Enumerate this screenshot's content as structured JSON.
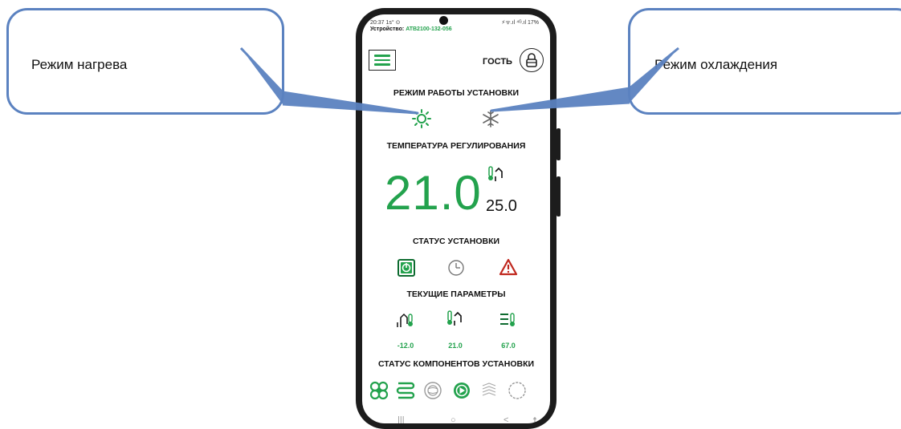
{
  "callouts": {
    "left": "Режим нагрева",
    "right": "Режим охлаждения"
  },
  "phone": {
    "status_time": "20:37 1s° ⊙",
    "status_right": "⚡ᯤ.ıl ⁴ᴳ.ıl 17%",
    "device_label": "Устройство:",
    "device_id": "ATB2100-132-056",
    "user": "ГОСТЬ",
    "section_mode": "РЕЖИМ РАБОТЫ УСТАНОВКИ",
    "section_temp": "ТЕМПЕРАТУРА РЕГУЛИРОВАНИЯ",
    "current_temp": "21.0",
    "setpoint_temp": "25.0",
    "section_status": "СТАТУС УСТАНОВКИ",
    "section_params": "ТЕКУЩИЕ ПАРАМЕТРЫ",
    "params": [
      "-12.0",
      "21.0",
      "67.0"
    ],
    "section_components": "СТАТУС КОМПОНЕНТОВ УСТАНОВКИ",
    "nav": [
      "|||",
      "○",
      "<",
      "☨"
    ]
  },
  "colors": {
    "accent": "#23a24d",
    "callout_border": "#5b82c0",
    "alarm": "#c0281f"
  },
  "icons": {
    "mode": [
      "sun-icon",
      "snowflake-icon"
    ],
    "status": [
      "power-icon",
      "clock-icon",
      "warning-icon"
    ],
    "params": [
      "outdoor-temp-icon",
      "indoor-temp-icon",
      "water-temp-icon"
    ],
    "components": [
      "fan-icon",
      "heater-icon",
      "filter-icon",
      "pump-icon",
      "cooler-icon",
      "compressor-icon"
    ]
  }
}
